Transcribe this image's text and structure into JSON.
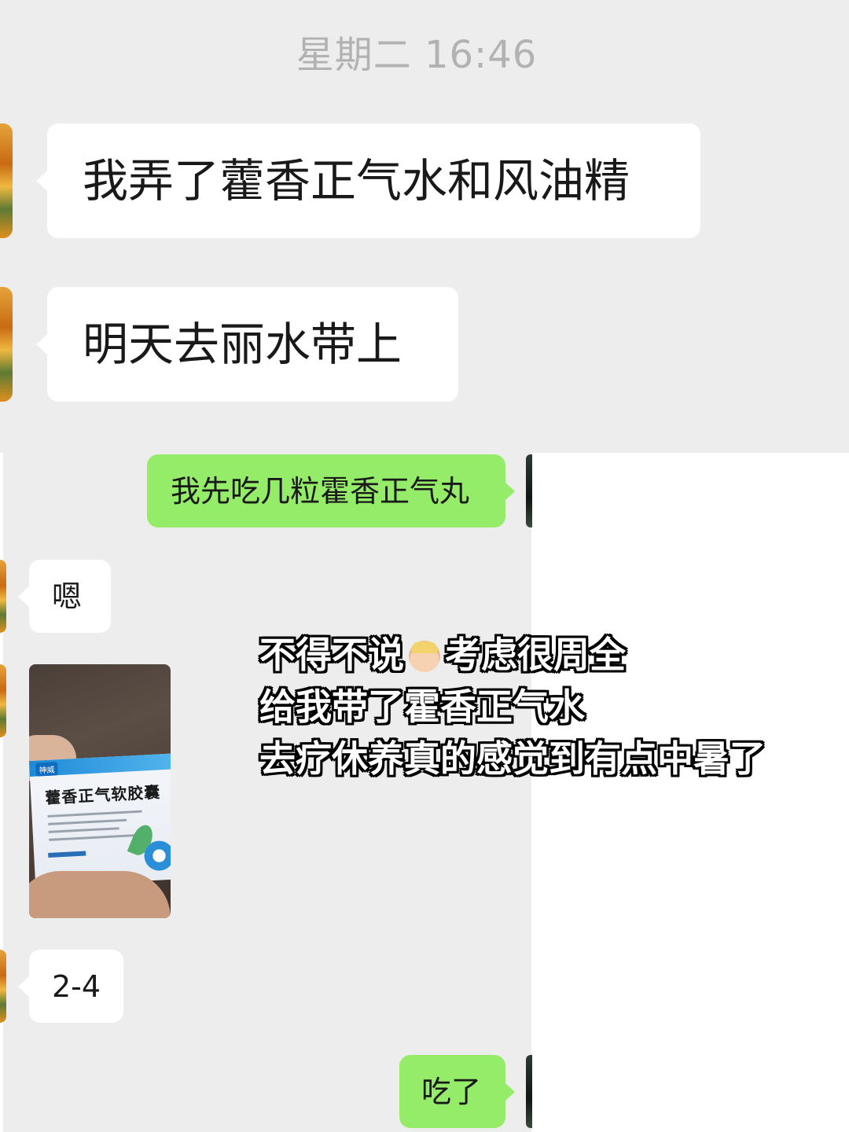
{
  "chat": {
    "timestamp": "星期二 16:46",
    "messages": [
      {
        "id": "m1",
        "side": "incoming",
        "type": "text",
        "text": "我弄了藿香正气水和风油精"
      },
      {
        "id": "m2",
        "side": "incoming",
        "type": "text",
        "text": "明天去丽水带上"
      },
      {
        "id": "m3",
        "side": "outgoing",
        "type": "text",
        "text": "我先吃几粒霍香正气丸"
      },
      {
        "id": "m4",
        "side": "incoming",
        "type": "text",
        "text": "嗯"
      },
      {
        "id": "m5",
        "side": "incoming",
        "type": "image",
        "image": {
          "brand": "神威",
          "product_name": "藿香正气软胶囊"
        }
      },
      {
        "id": "m6",
        "side": "incoming",
        "type": "text",
        "text": "2-4"
      },
      {
        "id": "m7",
        "side": "outgoing",
        "type": "text",
        "text": "吃了"
      }
    ]
  },
  "overlay": {
    "line1_before": "不得不说",
    "emoji": "blond-person-emoji",
    "line1_after": "考虑很周全",
    "line2": "给我带了霍香正气水",
    "line3": "去疗休养真的感觉到有点中暑了"
  },
  "colors": {
    "chat_background": "#ededed",
    "incoming_bubble": "#ffffff",
    "outgoing_bubble": "#95ec69",
    "timestamp_text": "#b2b2b2"
  }
}
